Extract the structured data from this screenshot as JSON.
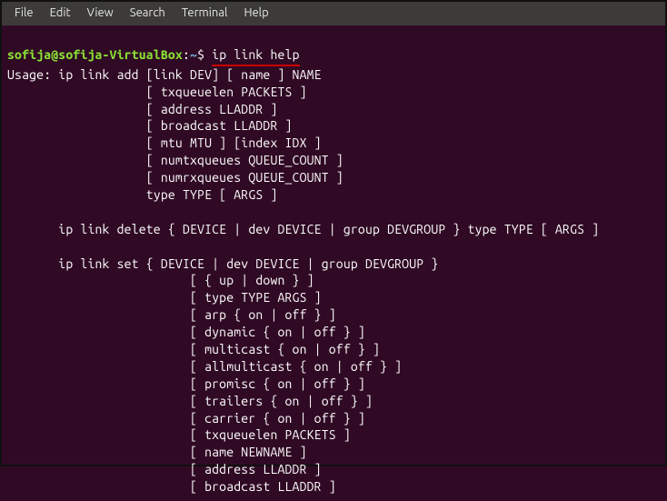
{
  "menu": {
    "file": "File",
    "edit": "Edit",
    "view": "View",
    "search": "Search",
    "terminal": "Terminal",
    "help": "Help"
  },
  "prompt": {
    "user_host": "sofija@sofija-VirtualBox",
    "colon": ":",
    "path": "~",
    "symbol": "$ ",
    "command": "ip link help"
  },
  "output": {
    "l01": "Usage: ip link add [link DEV] [ name ] NAME",
    "l02": "                   [ txqueuelen PACKETS ]",
    "l03": "                   [ address LLADDR ]",
    "l04": "                   [ broadcast LLADDR ]",
    "l05": "                   [ mtu MTU ] [index IDX ]",
    "l06": "                   [ numtxqueues QUEUE_COUNT ]",
    "l07": "                   [ numrxqueues QUEUE_COUNT ]",
    "l08": "                   type TYPE [ ARGS ]",
    "l09": "",
    "l10": "       ip link delete { DEVICE | dev DEVICE | group DEVGROUP } type TYPE [ ARGS ]",
    "l11": "",
    "l12": "       ip link set { DEVICE | dev DEVICE | group DEVGROUP }",
    "l13": "                         [ { up | down } ]",
    "l14": "                         [ type TYPE ARGS ]",
    "l15": "                         [ arp { on | off } ]",
    "l16": "                         [ dynamic { on | off } ]",
    "l17": "                         [ multicast { on | off } ]",
    "l18": "                         [ allmulticast { on | off } ]",
    "l19": "                         [ promisc { on | off } ]",
    "l20": "                         [ trailers { on | off } ]",
    "l21": "                         [ carrier { on | off } ]",
    "l22": "                         [ txqueuelen PACKETS ]",
    "l23": "                         [ name NEWNAME ]",
    "l24": "                         [ address LLADDR ]",
    "l25": "                         [ broadcast LLADDR ]"
  }
}
